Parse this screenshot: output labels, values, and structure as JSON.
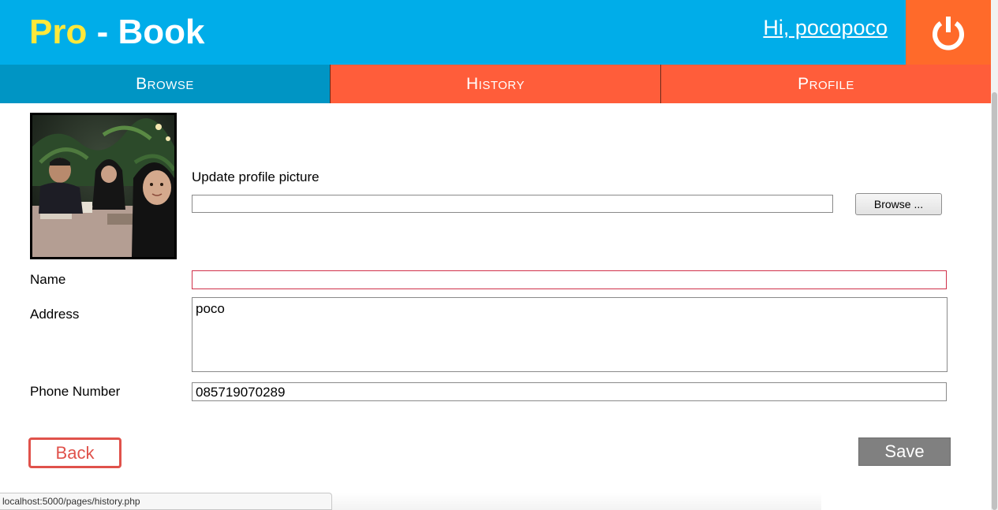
{
  "header": {
    "logo_pro": "Pro",
    "logo_rest": " - Book",
    "greeting": "Hi, pocopoco",
    "logout_icon": "power-icon"
  },
  "nav": {
    "tabs": [
      {
        "label": "Browse",
        "active": true
      },
      {
        "label": "History",
        "active": false
      },
      {
        "label": "Profile",
        "active": false
      }
    ]
  },
  "form": {
    "update_picture_label": "Update profile picture",
    "picture_file_value": "",
    "browse_label": "Browse ...",
    "name_label": "Name",
    "name_value": "",
    "address_label": "Address",
    "address_value": "poco",
    "phone_label": "Phone Number",
    "phone_value": "085719070289",
    "back_label": "Back",
    "save_label": "Save"
  },
  "status_bar": {
    "url": "localhost:5000/pages/history.php"
  },
  "colors": {
    "header_bg": "#00ade9",
    "logo_accent": "#ffe83a",
    "logout_bg": "#ff6a2a",
    "nav_active": "#0095c4",
    "nav_inactive": "#ff5d3a",
    "back_red": "#e0524b",
    "save_gray": "#808080"
  }
}
